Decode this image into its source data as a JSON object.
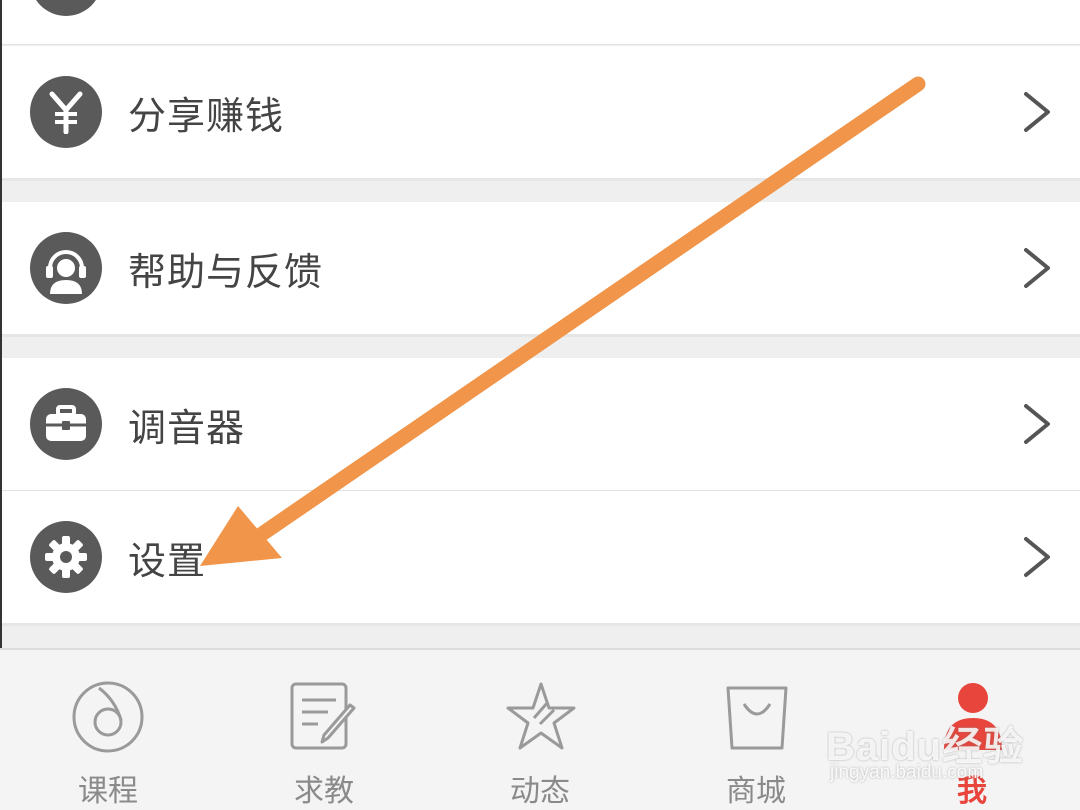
{
  "menu": {
    "items": [
      {
        "label": "分享赚钱",
        "icon": "yen-icon"
      },
      {
        "label": "帮助与反馈",
        "icon": "headset-icon"
      },
      {
        "label": "调音器",
        "icon": "toolbox-icon"
      },
      {
        "label": "设置",
        "icon": "gear-icon"
      }
    ]
  },
  "tabbar": {
    "tabs": [
      {
        "label": "课程",
        "icon": "course-icon",
        "active": false
      },
      {
        "label": "求教",
        "icon": "note-edit-icon",
        "active": false
      },
      {
        "label": "动态",
        "icon": "star-icon",
        "active": false
      },
      {
        "label": "商城",
        "icon": "shopping-bag-icon",
        "active": false
      },
      {
        "label": "我",
        "icon": "profile-icon",
        "active": true
      }
    ]
  },
  "watermark": {
    "brand": "Baidu经验",
    "url": "jingyan.baidu.com"
  },
  "colors": {
    "accent": "#e8453c",
    "arrow": "#f0954a",
    "icon_fill": "#5a5a5a",
    "label_text": "#444444",
    "tab_inactive": "#8a8a8a"
  }
}
